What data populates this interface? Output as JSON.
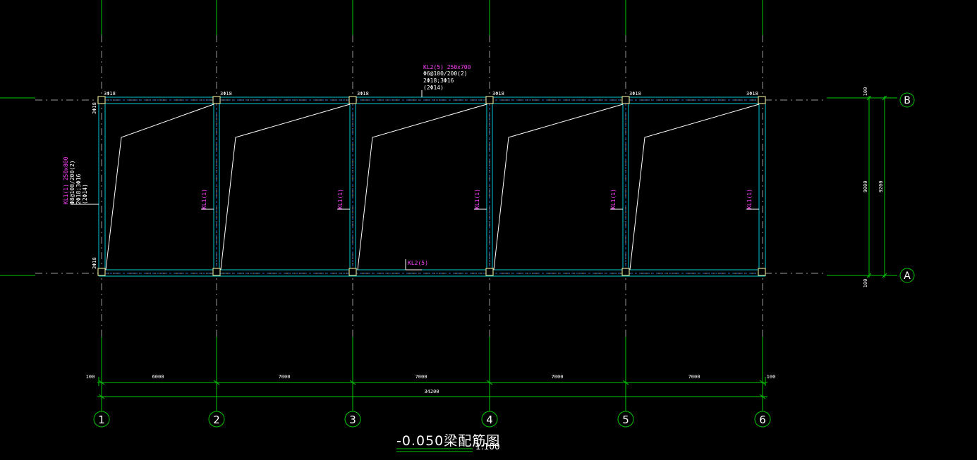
{
  "drawing": {
    "title": "-0.050梁配筋图",
    "scale": "1:100"
  },
  "grid": {
    "columns": [
      "1",
      "2",
      "3",
      "4",
      "5",
      "6"
    ],
    "rows": [
      "B",
      "A"
    ]
  },
  "dimensions": {
    "bottom_spans": [
      "100",
      "6000",
      "7000",
      "7000",
      "7000",
      "7000",
      "100"
    ],
    "bottom_total": "34200",
    "right_inner": "9000",
    "right_outer": "9200",
    "right_offset_top": "100",
    "right_offset_bottom": "100"
  },
  "annotations": {
    "kl2_top": [
      "KL2(5) 250x700",
      "Φ6@100/200(2)",
      "2Φ18;3Φ16",
      "(2Φ14)"
    ],
    "kl1_left": [
      "KL1(1) 250x800",
      "Φ8@100/200(2)",
      "2Φ18;3Φ16",
      "(2Φ14)"
    ],
    "kl1_short": "KL1(1)",
    "kl2_bottom": "KL2(5)",
    "rebar_top": "3Φ18",
    "rebar_left_top": "3Φ18",
    "rebar_left_bottom": "3Φ18"
  },
  "colors": {
    "grid_line": "#00c800",
    "axis_dash": "#9a9a9a",
    "beam": "#00c8d8",
    "column": "#d8d890",
    "label": "#ff40ff",
    "text": "#ffffff"
  }
}
